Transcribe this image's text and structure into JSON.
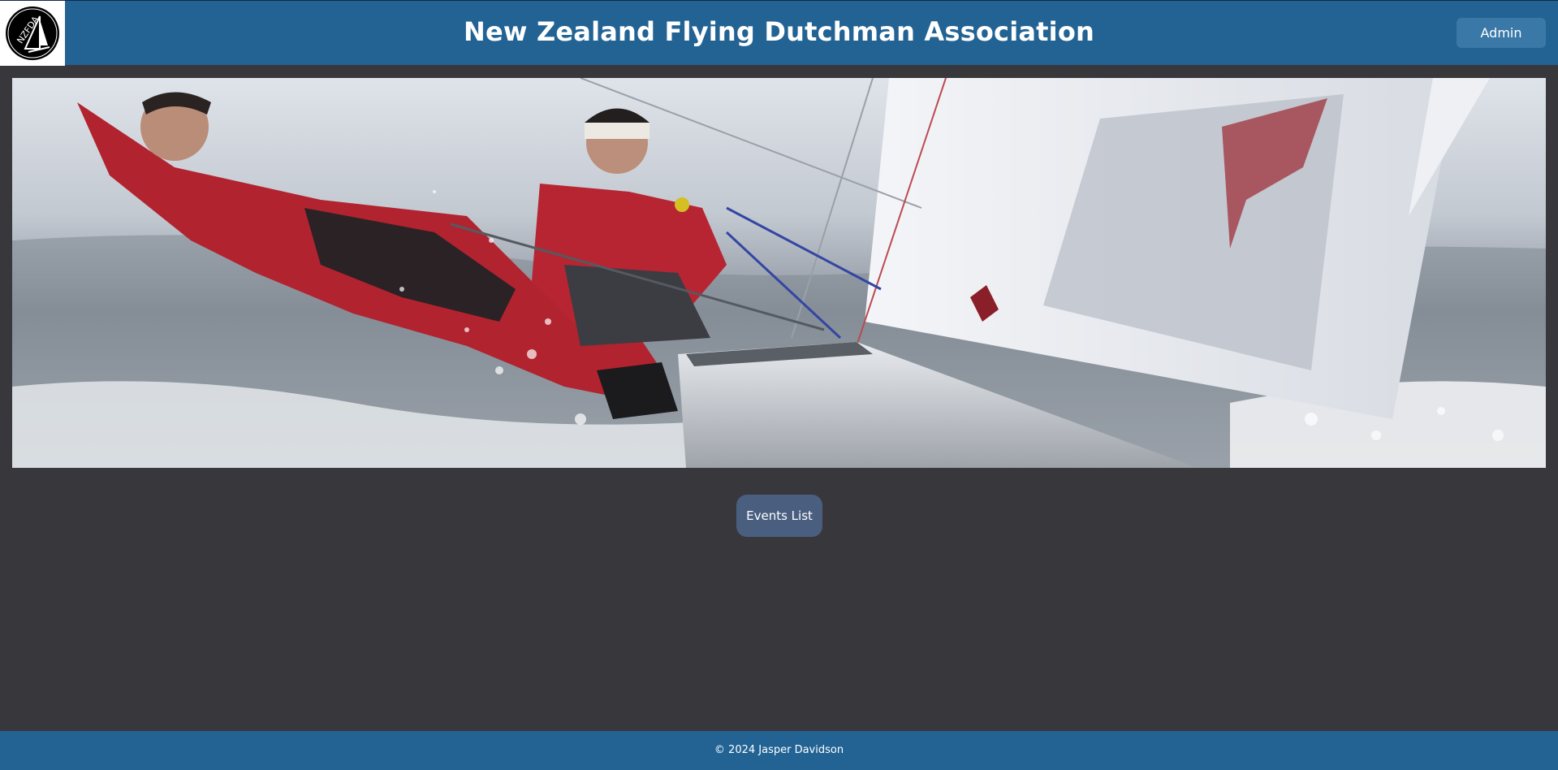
{
  "header": {
    "logo_alt": "NZFDA",
    "title": "New Zealand Flying Dutchman Association",
    "admin_label": "Admin"
  },
  "hero": {
    "image_name": "hero-sailing-photo"
  },
  "main": {
    "events_label": "Events List"
  },
  "footer": {
    "copyright": "© 2024 Jasper Davidson"
  },
  "colors": {
    "header_bg": "#226394",
    "page_bg": "#38373c",
    "admin_button": "#3a78a7",
    "events_button": "#4a5f80",
    "footer_bg": "#226394"
  }
}
